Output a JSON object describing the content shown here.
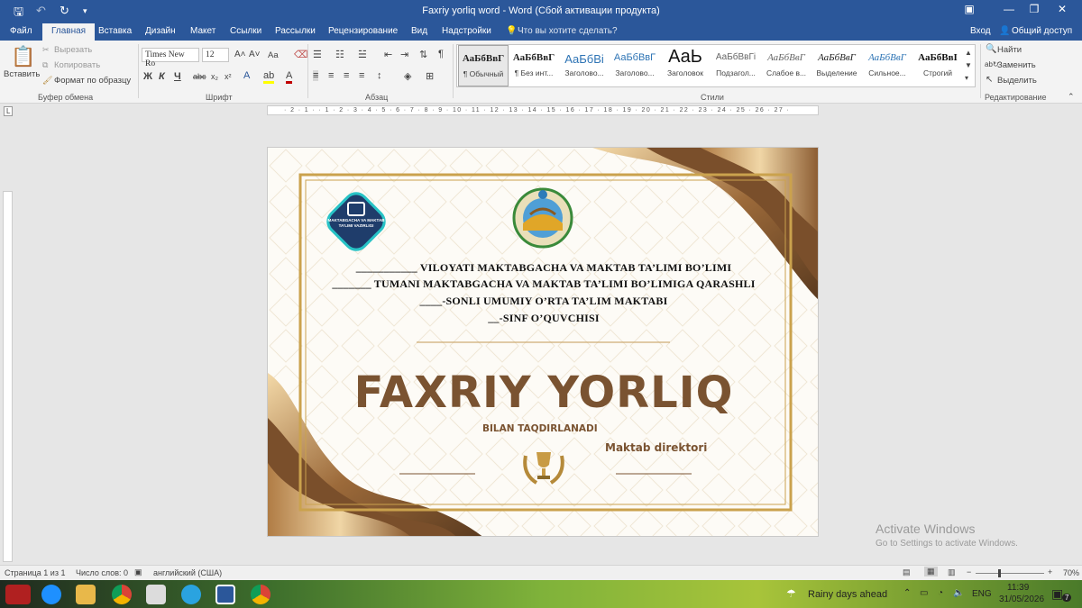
{
  "window": {
    "title": "Faxriy yorliq word  -  Word (Сбой активации продукта)",
    "controls": {
      "ribbon_opts": "▣",
      "minimize": "—",
      "restore": "❐",
      "close": "✕"
    }
  },
  "tabs": [
    "Файл",
    "Главная",
    "Вставка",
    "Дизайн",
    "Макет",
    "Ссылки",
    "Рассылки",
    "Рецензирование",
    "Вид",
    "Надстройки"
  ],
  "tell_me": "Что вы хотите сделать?",
  "account": {
    "signin": "Вход",
    "share": "Общий доступ"
  },
  "clipboard": {
    "paste": "Вставить",
    "cut": "Вырезать",
    "copy": "Копировать",
    "format_painter": "Формат по образцу",
    "label": "Буфер обмена"
  },
  "font": {
    "name": "Times New Ro",
    "size": "12",
    "label": "Шрифт",
    "bold": "Ж",
    "italic": "К",
    "underline": "Ч",
    "case": "Aa"
  },
  "paragraph": {
    "label": "Абзац"
  },
  "styles": {
    "label": "Стили",
    "items": [
      {
        "preview": "АаБбВвГ",
        "name": "¶ Обычный"
      },
      {
        "preview": "АаБбВвГ",
        "name": "¶ Без инт..."
      },
      {
        "preview": "АаБбВі",
        "name": "Заголово..."
      },
      {
        "preview": "АаБбВвГ",
        "name": "Заголово..."
      },
      {
        "preview": "АаЬ",
        "name": "Заголовок"
      },
      {
        "preview": "АаБбВвГі",
        "name": "Подзагол..."
      },
      {
        "preview": "АаБбВвГ",
        "name": "Слабое в..."
      },
      {
        "preview": "АаБбВвГ",
        "name": "Выделение"
      },
      {
        "preview": "АаБбВвГ",
        "name": "Сильное..."
      },
      {
        "preview": "АаБбВвІ",
        "name": "Строгий"
      }
    ]
  },
  "editing": {
    "find": "Найти",
    "replace": "Заменить",
    "select": "Выделить",
    "label": "Редактирование"
  },
  "ruler": {
    "h": "· 2 · 1 ·   · 1 · 2 · 3 · 4 · 5 · 6 · 7 · 8 · 9 · 10 · 11 · 12 · 13 · 14 · 15 · 16 · 17 · 18 · 19 · 20 · 21 · 22 · 23 · 24 · 25 · 26 · 27 ·"
  },
  "certificate": {
    "line1": "___________ VILOYATI MAKTABGACHA VA MAKTAB TA’LIMI BO’LIMI",
    "line2": "_______ TUMANI MAKTABGACHA VA MAKTAB TA’LIMI BO’LIMIGA QARASHLI",
    "line3": "____-SONLI UMUMIY O’RTA TA’LIM MAKTABI",
    "line4": "__-SINF O’QUVCHISI",
    "title": "FAXRIY YORLIQ",
    "subtitle": "BILAN TAQDIRLANADI",
    "director": "Maktab direktori",
    "logo_text": "MAKTABGACHA VA MAKTAB TA’LIMI VAZIRLIGI"
  },
  "status": {
    "page": "Страница 1 из 1",
    "words": "Число слов: 0",
    "language": "английский (США)",
    "zoom": "70%"
  },
  "watermark": {
    "line1": "Activate Windows",
    "line2": "Go to Settings to activate Windows."
  },
  "taskbar": {
    "weather": "Rainy days ahead",
    "lang": "ENG",
    "time": "11:39",
    "date": "31/05/2026",
    "badge": "7"
  }
}
